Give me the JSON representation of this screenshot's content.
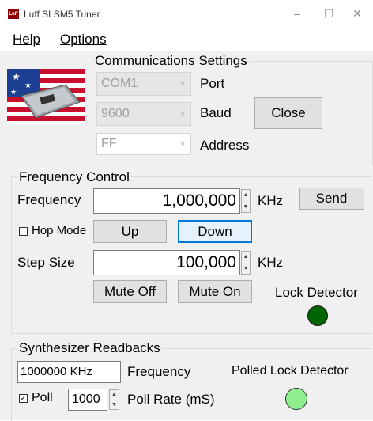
{
  "window": {
    "title": "Luff SLSM5 Tuner",
    "icon_text": "Luff",
    "minimize": "–",
    "maximize": "☐",
    "close": "✕"
  },
  "menu": {
    "help": "Help",
    "options": "Options"
  },
  "comms": {
    "title": "Communications Settings",
    "port_value": "COM1",
    "port_label": "Port",
    "baud_value": "9600",
    "baud_label": "Baud",
    "address_value": "FF",
    "address_label": "Address",
    "close_button": "Close"
  },
  "freq_control": {
    "title": "Frequency Control",
    "frequency_label": "Frequency",
    "frequency_value": "1,000,000",
    "frequency_unit": "KHz",
    "send_button": "Send",
    "hop_mode_label": "Hop Mode",
    "hop_mode_checked": false,
    "up_button": "Up",
    "down_button": "Down",
    "step_label": "Step Size",
    "step_value": "100,000",
    "step_unit": "KHz",
    "mute_off_button": "Mute Off",
    "mute_on_button": "Mute On",
    "lock_detector_label": "Lock Detector",
    "lock_color": "#006400"
  },
  "readbacks": {
    "title": "Synthesizer Readbacks",
    "frequency_value": "1000000 KHz",
    "frequency_label": "Frequency",
    "polled_lock_label": "Polled Lock Detector",
    "polled_lock_color": "#90ee90",
    "poll_label": "Poll",
    "poll_checked": true,
    "poll_rate_value": "1000",
    "poll_rate_label": "Poll Rate (mS)"
  }
}
